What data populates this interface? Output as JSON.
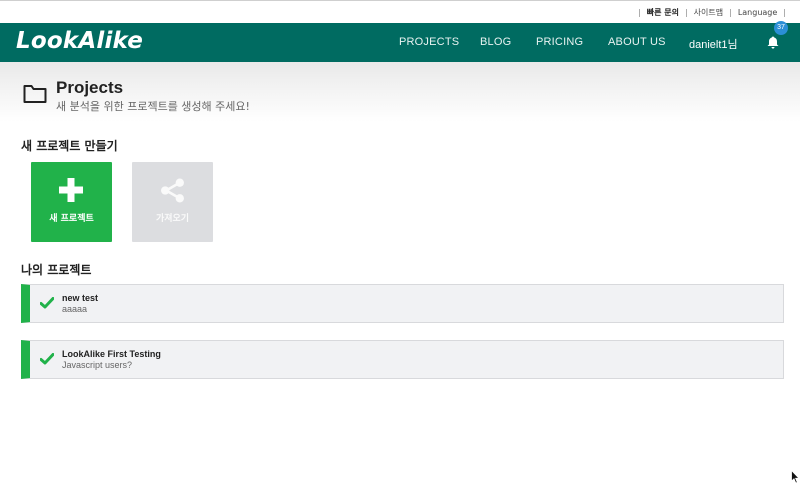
{
  "topbar": {
    "links": [
      {
        "label": "빠른 문의",
        "bold": true
      },
      {
        "label": "사이트맵",
        "bold": false
      },
      {
        "label": "Language",
        "bold": false
      }
    ]
  },
  "navbar": {
    "logo": "LookAlike",
    "items": [
      "PROJECTS",
      "BLOG",
      "PRICING",
      "ABOUT US"
    ],
    "user": "danielt1님",
    "notification_count": "37",
    "icons": [
      "caret-down-icon",
      "bell-icon"
    ]
  },
  "header": {
    "title": "Projects",
    "subtitle": "새 분석을 위한 프로젝트를 생성해 주세요!",
    "icon": "folder-icon"
  },
  "create_section": {
    "title": "새 프로젝트 만들기",
    "new_card": {
      "label": "새 프로젝트",
      "icon": "plus-icon",
      "color": "#21b24a"
    },
    "import_card": {
      "label": "가져오기",
      "icon": "share-icon",
      "color": "#dcdde0"
    }
  },
  "my_projects": {
    "title": "나의 프로젝트",
    "items": [
      {
        "name": "new test",
        "description": "aaaaa",
        "status_icon": "check-icon"
      },
      {
        "name": "LookAlike First Testing",
        "description": "Javascript users?",
        "status_icon": "check-icon"
      }
    ]
  },
  "colors": {
    "nav_bg": "#006b61",
    "accent_green": "#21b24a",
    "badge_blue": "#2b8fd6"
  }
}
